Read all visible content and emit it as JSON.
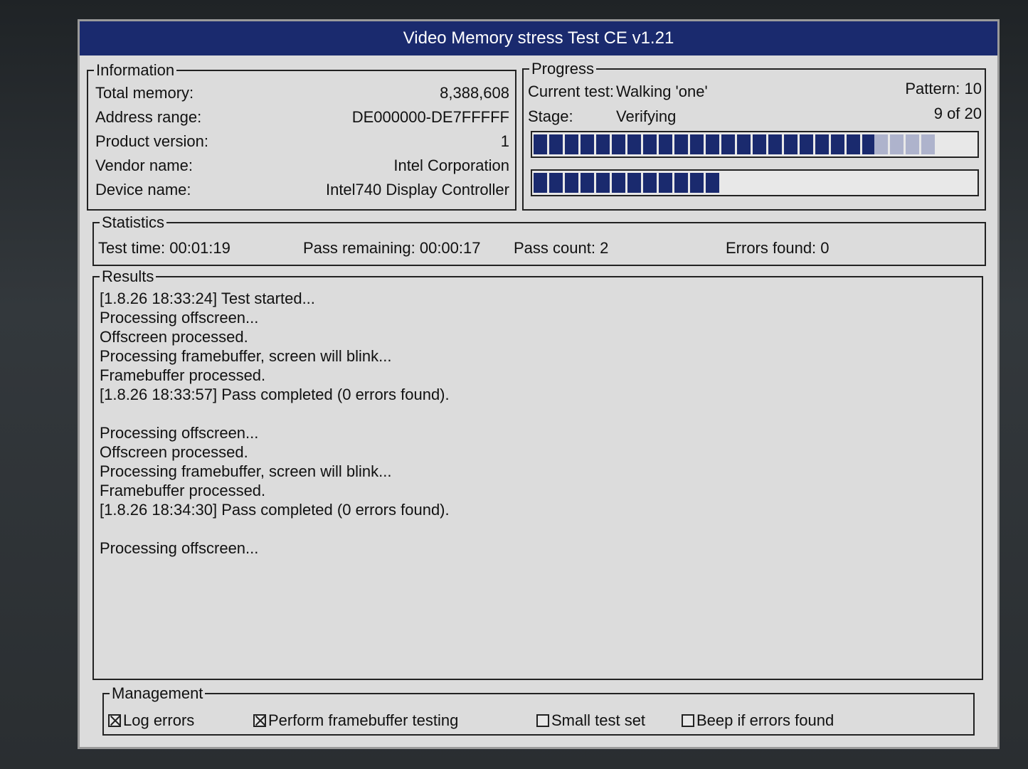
{
  "window": {
    "title": "Video Memory stress Test CE v1.21"
  },
  "information": {
    "label": "Information",
    "rows": [
      {
        "key": "Total memory:",
        "value": "8,388,608"
      },
      {
        "key": "Address range:",
        "value": "DE000000-DE7FFFFF"
      },
      {
        "key": "Product version:",
        "value": "1"
      },
      {
        "key": "Vendor name:",
        "value": "Intel Corporation"
      },
      {
        "key": "Device name:",
        "value": "Intel740 Display Controller"
      }
    ]
  },
  "progress": {
    "label": "Progress",
    "current_test_label": "Current test:",
    "current_test_value": "Walking 'one'",
    "pattern": "Pattern: 10",
    "stage_label": "Stage:",
    "stage_value": "Verifying",
    "stage_count": "9 of 20",
    "bar1_fraction": 0.77,
    "bar1_ghost_fraction": 0.14,
    "bar2_fraction": 0.42,
    "bar_color": "#1a2a6e"
  },
  "statistics": {
    "label": "Statistics",
    "test_time": "Test time:  00:01:19",
    "pass_remaining": "Pass remaining:  00:00:17",
    "pass_count": "Pass count:  2",
    "errors_found": "Errors found:  0"
  },
  "results": {
    "label": "Results",
    "lines": [
      "[1.8.26 18:33:24] Test started...",
      "Processing offscreen...",
      "Offscreen processed.",
      "Processing framebuffer, screen will blink...",
      "Framebuffer processed.",
      "[1.8.26 18:33:57] Pass completed (0 errors found).",
      "",
      "Processing offscreen...",
      "Offscreen processed.",
      "Processing framebuffer, screen will blink...",
      "Framebuffer processed.",
      "[1.8.26 18:34:30] Pass completed (0 errors found).",
      "",
      "Processing offscreen..."
    ]
  },
  "management": {
    "label": "Management",
    "options": [
      {
        "label": "Log errors",
        "checked": true
      },
      {
        "label": "Perform framebuffer testing",
        "checked": true
      },
      {
        "label": "Small test set",
        "checked": false
      },
      {
        "label": "Beep if errors found",
        "checked": false
      }
    ]
  }
}
